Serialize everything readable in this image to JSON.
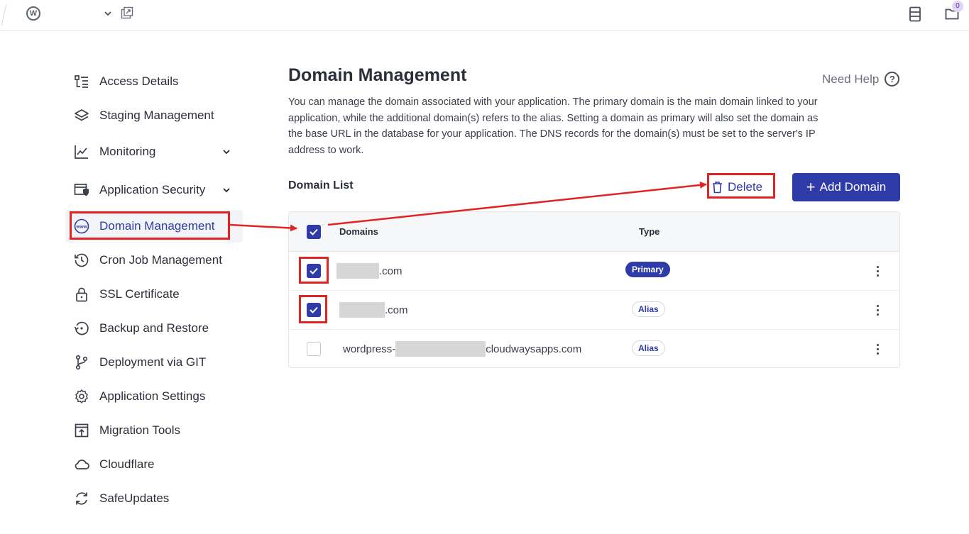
{
  "topbar": {
    "badge_count": "0",
    "icons": [
      "wordpress-icon",
      "chevron-down-icon",
      "external-link-icon",
      "server-icon",
      "folder-icon"
    ]
  },
  "sidebar": {
    "items": [
      {
        "label": "Access Details",
        "icon": "access-details-icon"
      },
      {
        "label": "Staging Management",
        "icon": "layers-icon"
      },
      {
        "label": "Monitoring",
        "icon": "chart-line-icon",
        "has_chevron": true
      },
      {
        "label": "Application Security",
        "icon": "shield-window-icon",
        "has_chevron": true
      },
      {
        "label": "Domain Management",
        "icon": "www-globe-icon",
        "active": true
      },
      {
        "label": "Cron Job Management",
        "icon": "history-icon"
      },
      {
        "label": "SSL Certificate",
        "icon": "lock-icon"
      },
      {
        "label": "Backup and Restore",
        "icon": "restore-icon"
      },
      {
        "label": "Deployment via GIT",
        "icon": "git-branch-icon"
      },
      {
        "label": "Application Settings",
        "icon": "gear-icon"
      },
      {
        "label": "Migration Tools",
        "icon": "migration-icon"
      },
      {
        "label": "Cloudflare",
        "icon": "cloud-icon"
      },
      {
        "label": "SafeUpdates",
        "icon": "refresh-icon"
      }
    ]
  },
  "main": {
    "title": "Domain Management",
    "help_label": "Need Help",
    "help_icon": "?",
    "description": "You can manage the domain associated with your application. The primary domain is the main domain linked to your application, while the additional domain(s) refers to the alias. Setting a domain as primary will also set the domain as the base URL in the database for your application. The DNS records for the domain(s) must be set to the server's IP address to work.",
    "domain_list_title": "Domain List",
    "delete_label": "Delete",
    "add_domain_label": "Add Domain",
    "add_domain_icon": "+",
    "table": {
      "columns": [
        "Domains",
        "Type"
      ],
      "select_all_checked": true,
      "rows": [
        {
          "domain_prefix": "",
          "domain_suffix": ".com",
          "type": "Primary",
          "checked": true
        },
        {
          "domain_prefix": "",
          "domain_suffix": ".com",
          "type": "Alias",
          "checked": true
        },
        {
          "domain_prefix": "wordpress-",
          "domain_suffix": "cloudwaysapps.com",
          "type": "Alias",
          "checked": false
        }
      ]
    }
  },
  "colors": {
    "accent": "#2e3ba8",
    "highlight": "#e02424",
    "text": "#2b2f3a"
  }
}
